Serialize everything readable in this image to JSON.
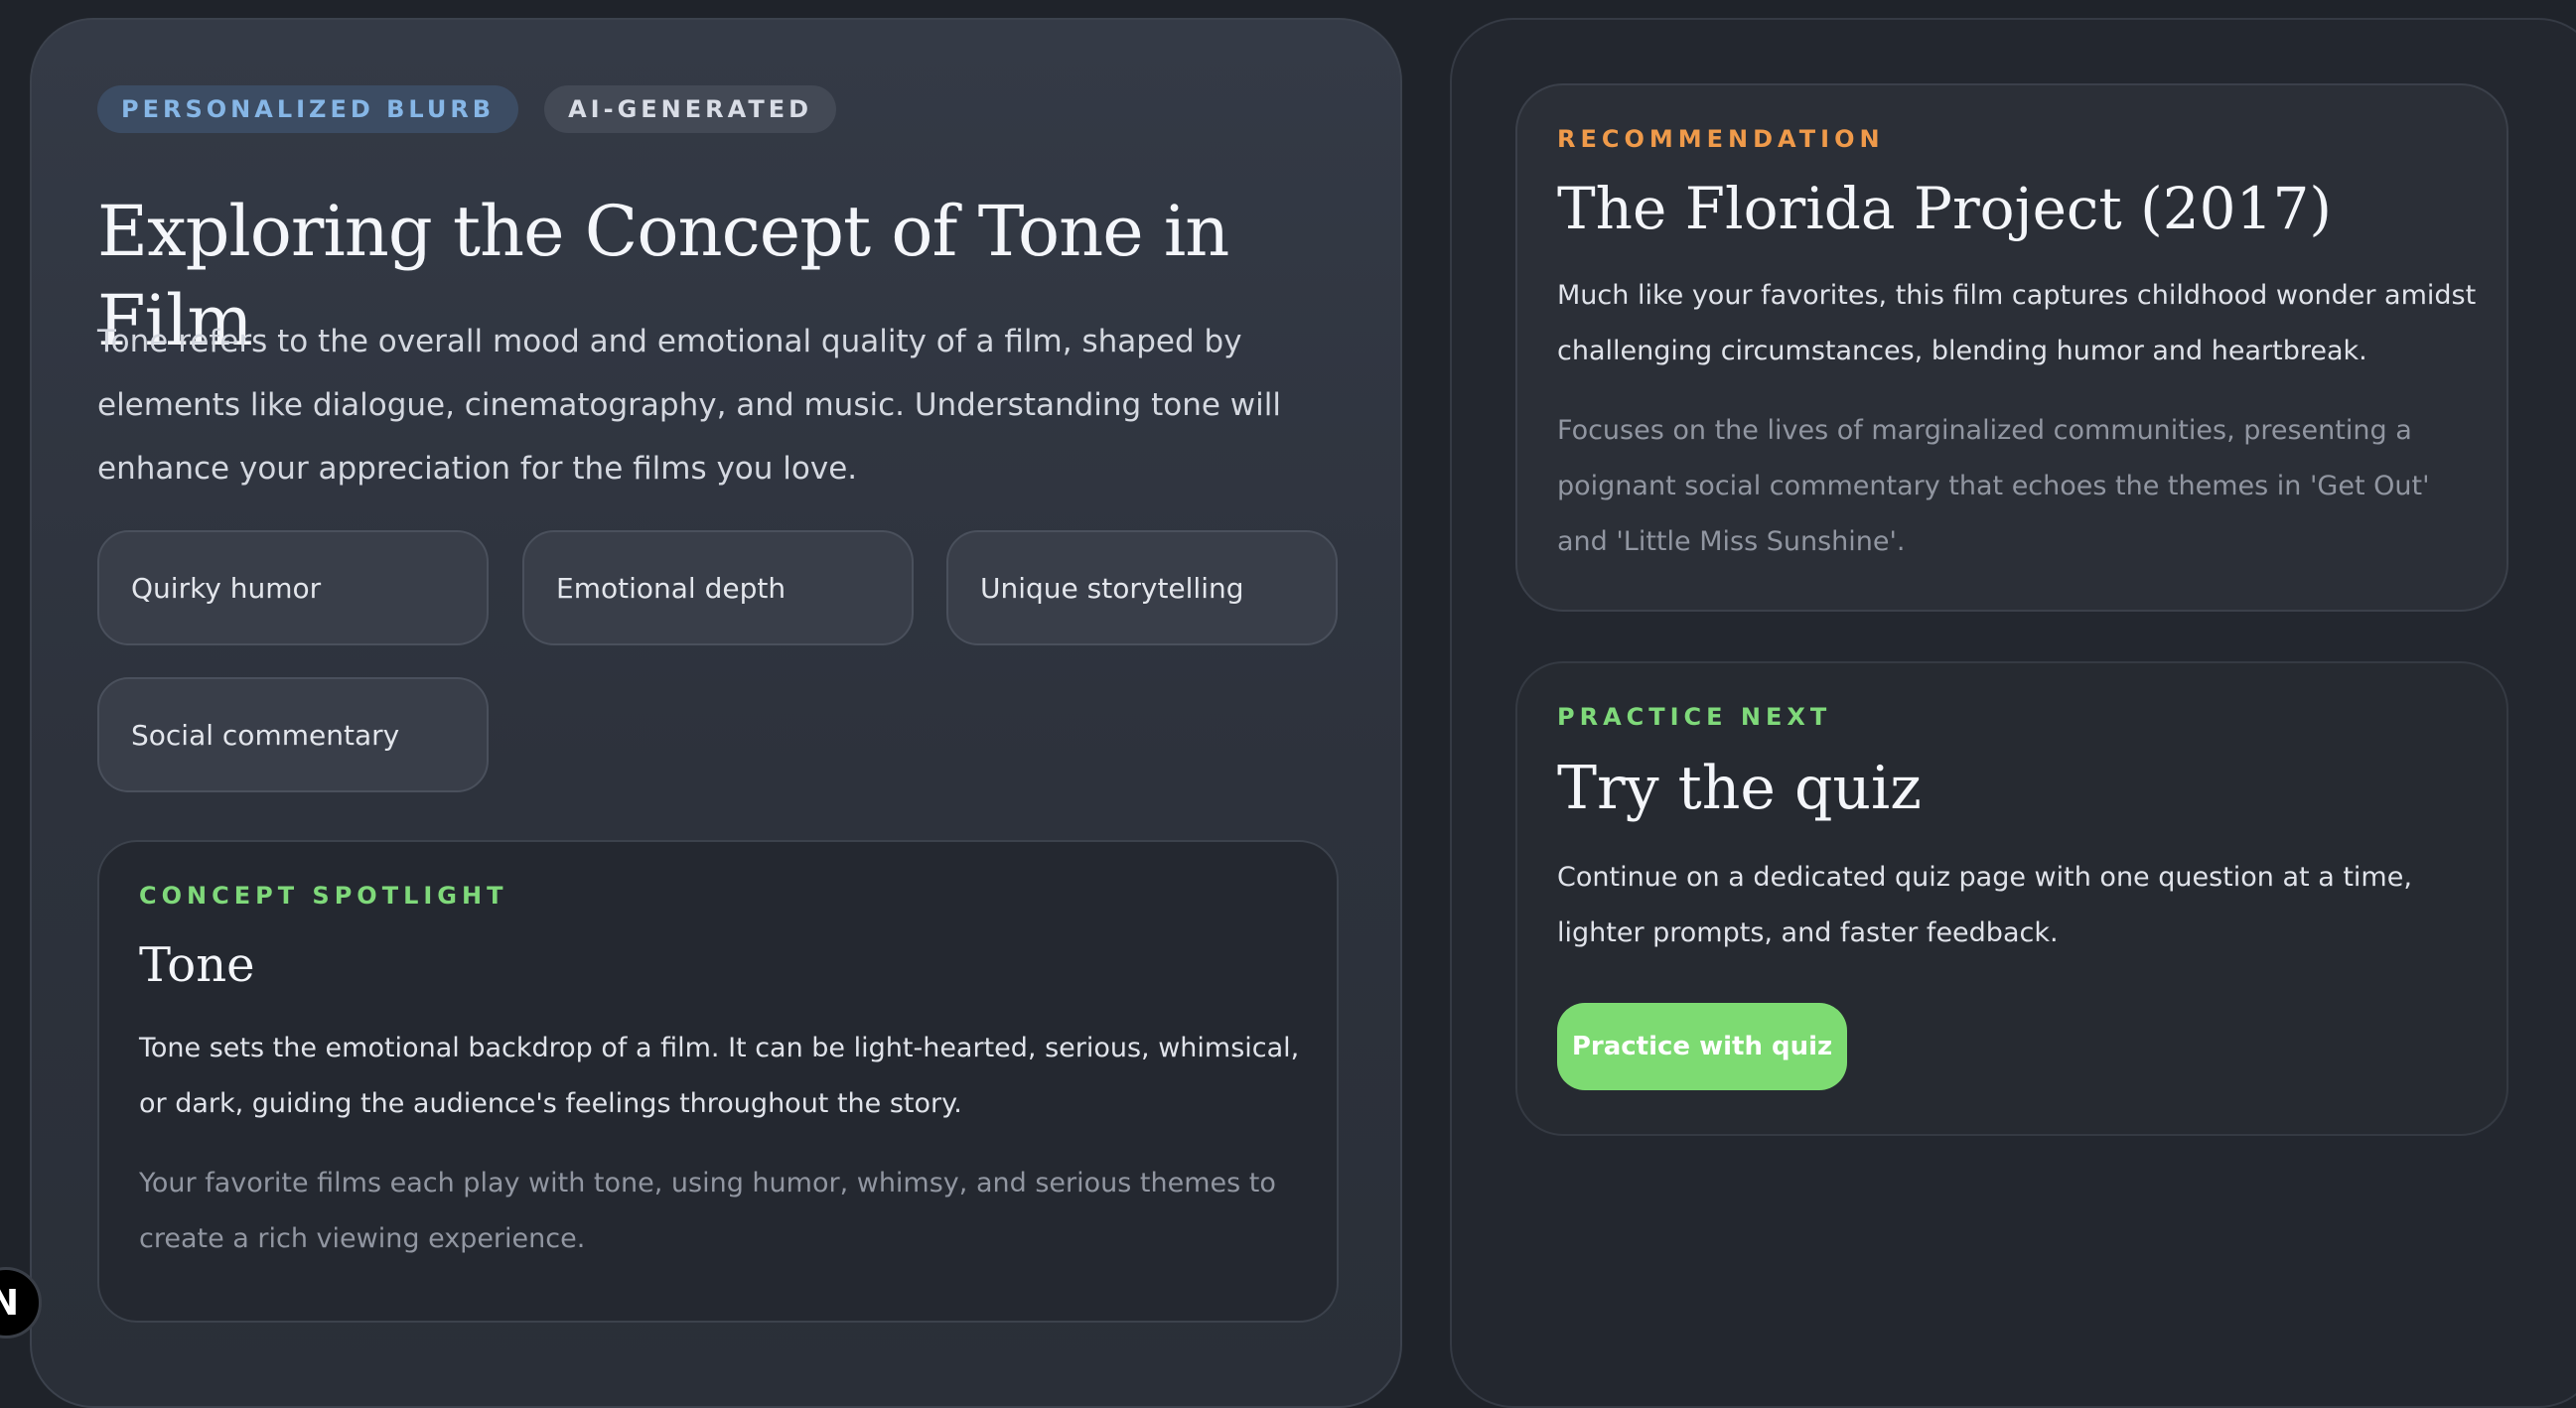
{
  "blurb": {
    "badges": [
      "PERSONALIZED BLURB",
      "AI-GENERATED"
    ],
    "title": "Exploring the Concept of Tone in Film",
    "description": "Tone refers to the overall mood and emotional quality of a film, shaped by elements like dialogue, cinematography, and music. Understanding tone will enhance your appreciation for the films you love.",
    "chips": [
      "Quirky humor",
      "Emotional depth",
      "Unique storytelling",
      "Social commentary"
    ]
  },
  "spotlight": {
    "eyebrow": "CONCEPT SPOTLIGHT",
    "title": "Tone",
    "text": "Tone sets the emotional backdrop of a film. It can be light-hearted, serious, whimsical, or dark, guiding the audience's feelings throughout the story.",
    "muted": "Your favorite films each play with tone, using humor, whimsy, and serious themes to create a rich viewing experience."
  },
  "recommendation": {
    "eyebrow": "RECOMMENDATION",
    "title": "The Florida Project (2017)",
    "text": "Much like your favorites, this film captures childhood wonder amidst challenging circumstances, blending humor and heartbreak.",
    "muted": "Focuses on the lives of marginalized communities, presenting a poignant social commentary that echoes the themes in 'Get Out' and 'Little Miss Sunshine'."
  },
  "practice": {
    "eyebrow": "PRACTICE NEXT",
    "title": "Try the quiz",
    "text": "Continue on a dedicated quiz page with one question at a time, lighter prompts, and faster feedback.",
    "button": "Practice with quiz"
  },
  "logo": {
    "letter": "N"
  },
  "colors": {
    "accent_green": "#7ddb72",
    "eyebrow_orange": "#ef9a4a",
    "badge_blue": "#86b6e6"
  }
}
